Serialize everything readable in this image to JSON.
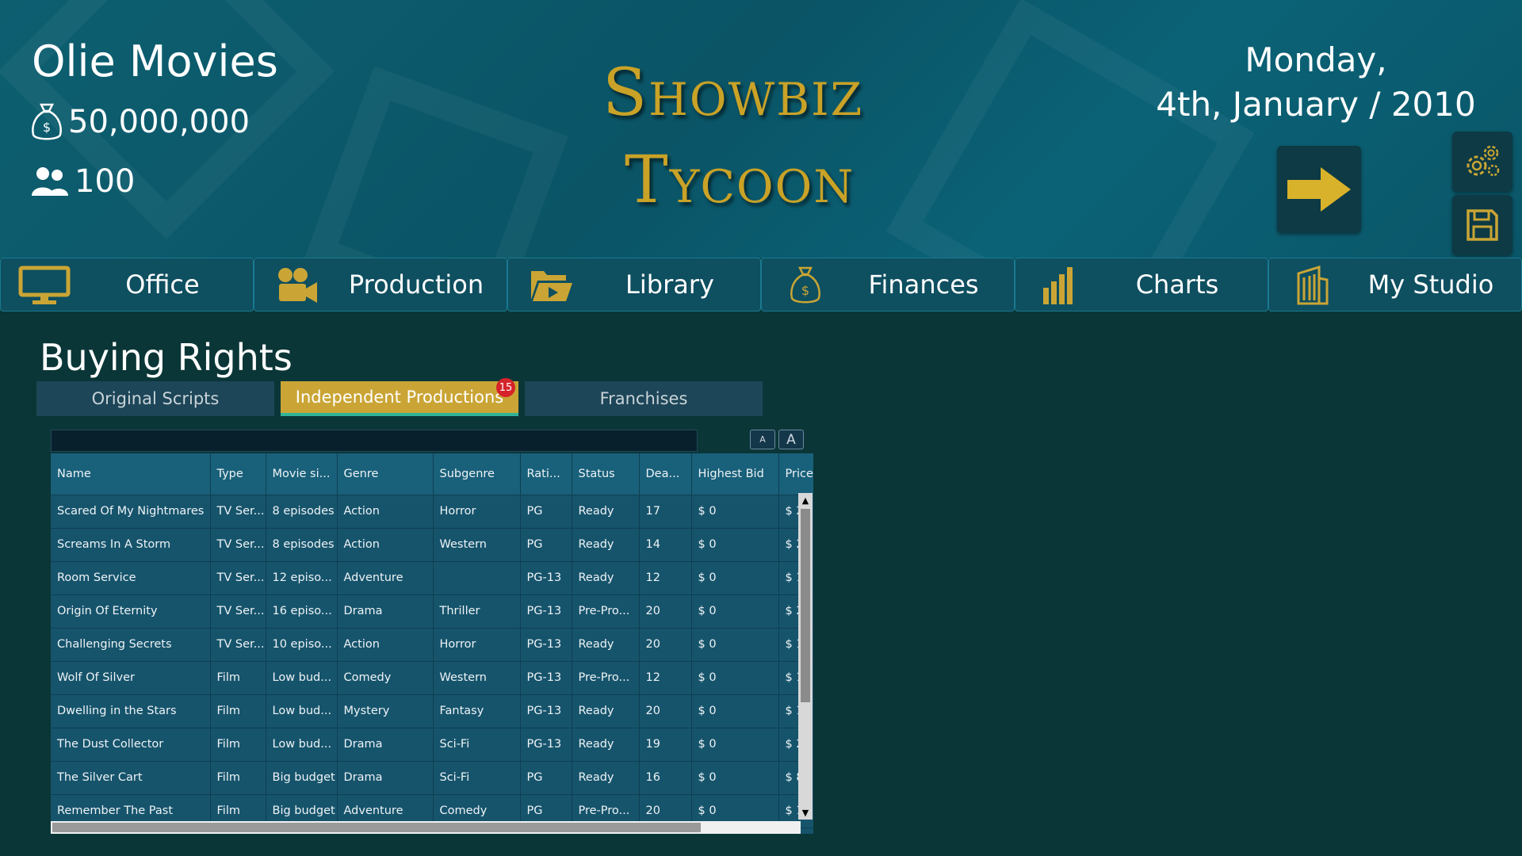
{
  "header": {
    "studio_name": "Olie Movies",
    "money": "50,000,000",
    "fans": "100",
    "logo_line1": "Showbiz",
    "logo_line2": "Tycoon",
    "date_line1": "Monday,",
    "date_line2": "4th, January / 2010"
  },
  "icons": {
    "money": "money-bag-icon",
    "fans": "people-icon",
    "next": "arrow-right-icon",
    "settings": "gears-icon",
    "save": "floppy-disk-icon"
  },
  "nav": [
    {
      "label": "Office",
      "icon": "monitor-icon"
    },
    {
      "label": "Production",
      "icon": "camera-icon"
    },
    {
      "label": "Library",
      "icon": "folder-icon"
    },
    {
      "label": "Finances",
      "icon": "money-bag-icon"
    },
    {
      "label": "Charts",
      "icon": "bar-chart-icon"
    },
    {
      "label": "My Studio",
      "icon": "building-icon"
    }
  ],
  "section_title": "Buying Rights",
  "tabs": [
    {
      "label": "Original Scripts",
      "active": false
    },
    {
      "label": "Independent Productions",
      "active": true,
      "badge": "15"
    },
    {
      "label": "Franchises",
      "active": false
    }
  ],
  "font_buttons": {
    "small": "A",
    "large": "A"
  },
  "table": {
    "columns": [
      "Name",
      "Type",
      "Movie si...",
      "Genre",
      "Subgenre",
      "Rati...",
      "Status",
      "Dea...",
      "Highest Bid",
      "Price"
    ],
    "rows": [
      [
        "Scared Of My Nightmares",
        "TV Ser...",
        "8 episodes",
        "Action",
        "Horror",
        "PG",
        "Ready",
        "17",
        "$ 0",
        "$ 2"
      ],
      [
        "Screams In A Storm",
        "TV Ser...",
        "8 episodes",
        "Action",
        "Western",
        "PG",
        "Ready",
        "14",
        "$ 0",
        "$ 2"
      ],
      [
        "Room Service",
        "TV Ser...",
        "12 episo...",
        "Adventure",
        "",
        "PG-13",
        "Ready",
        "12",
        "$ 0",
        "$ 1"
      ],
      [
        "Origin Of Eternity",
        "TV Ser...",
        "16 episo...",
        "Drama",
        "Thriller",
        "PG-13",
        "Pre-Pro...",
        "20",
        "$ 0",
        "$ 2"
      ],
      [
        "Challenging Secrets",
        "TV Ser...",
        "10 episo...",
        "Action",
        "Horror",
        "PG-13",
        "Ready",
        "20",
        "$ 0",
        "$ 1"
      ],
      [
        "Wolf Of Silver",
        "Film",
        "Low bud...",
        "Comedy",
        "Western",
        "PG-13",
        "Pre-Pro...",
        "12",
        "$ 0",
        "$ 1"
      ],
      [
        "Dwelling in the Stars",
        "Film",
        "Low bud...",
        "Mystery",
        "Fantasy",
        "PG-13",
        "Ready",
        "20",
        "$ 0",
        "$ 1"
      ],
      [
        "The Dust Collector",
        "Film",
        "Low bud...",
        "Drama",
        "Sci-Fi",
        "PG-13",
        "Ready",
        "19",
        "$ 0",
        "$ 2"
      ],
      [
        "The Silver Cart",
        "Film",
        "Big budget",
        "Drama",
        "Sci-Fi",
        "PG",
        "Ready",
        "16",
        "$ 0",
        "$ 8"
      ],
      [
        "Remember The Past",
        "Film",
        "Big budget",
        "Adventure",
        "Comedy",
        "PG",
        "Pre-Pro...",
        "20",
        "$ 0",
        "$ 1"
      ]
    ]
  },
  "colors": {
    "accent_gold": "#caa535",
    "header_teal": "#0a5668",
    "background": "#0b3637",
    "badge_red": "#d5232a"
  }
}
